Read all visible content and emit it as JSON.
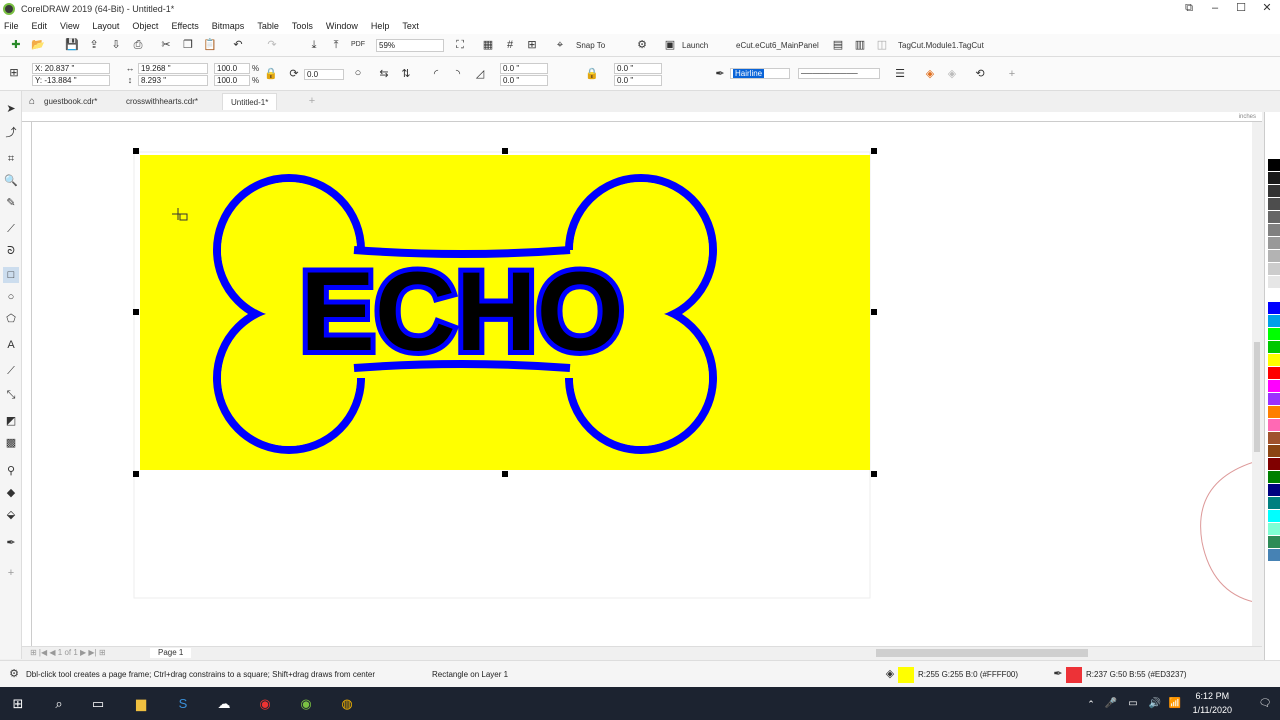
{
  "window": {
    "title": "CorelDRAW 2019 (64-Bit) - Untitled-1*"
  },
  "menu": [
    "File",
    "Edit",
    "View",
    "Layout",
    "Object",
    "Effects",
    "Bitmaps",
    "Table",
    "Tools",
    "Window",
    "Help",
    "Text"
  ],
  "toolbar": {
    "zoom": "59%",
    "snap_label": "Snap To",
    "launch_label": "Launch",
    "ecut_label": "eCut.eCut6_MainPanel",
    "tagcut_label": "TagCut.Module1.TagCut"
  },
  "propbar": {
    "x": "X: 20.837 \"",
    "y": "Y: -13.884 \"",
    "w": "19.268 \"",
    "h": "8.293 \"",
    "scale_x": "100.0",
    "scale_y": "100.0",
    "pct": "%",
    "rotation": "0.0",
    "corner1": "0.0 \"",
    "corner2": "0.0 \"",
    "corner3": "0.0 \"",
    "corner4": "0.0 \"",
    "outline": "Hairline"
  },
  "doc_tabs": [
    "guestbook.cdr*",
    "crosswithhearts.cdr*",
    "Untitled-1*"
  ],
  "artwork": {
    "text": "ECHO",
    "bg_color": "#FFFF00",
    "stroke_color": "#0000FF",
    "text_color": "#000000"
  },
  "page_nav": {
    "page_label": "Page 1",
    "of": "of"
  },
  "ruler_unit": "inches",
  "status": {
    "hint": "Dbl-click tool creates a page frame; Ctrl+drag constrains to a square; Shift+drag draws from center",
    "object": "Rectangle on Layer 1",
    "fill": "R:255 G:255 B:0 (#FFFF00)",
    "outline": "R:237 G:50 B:55 (#ED3237)",
    "fill_color": "#FFFF00",
    "outline_color": "#ED3237"
  },
  "taskbar": {
    "time": "6:12 PM",
    "date": "1/11/2020"
  },
  "palette": [
    "#ffffff",
    "#000000",
    "#1a1a1a",
    "#333333",
    "#4d4d4d",
    "#666666",
    "#808080",
    "#999999",
    "#b3b3b3",
    "#cccccc",
    "#e6e6e6",
    "#ffffff",
    "#0000ff",
    "#00a0e9",
    "#00ff00",
    "#00c800",
    "#ffff00",
    "#ff0000",
    "#ff00ff",
    "#9b30ff",
    "#ff7f00",
    "#ff69b4",
    "#a0522d",
    "#8b4513",
    "#800000",
    "#008000",
    "#000080",
    "#008080",
    "#00ffff",
    "#7fffd4",
    "#2e8b57",
    "#4682b4"
  ]
}
